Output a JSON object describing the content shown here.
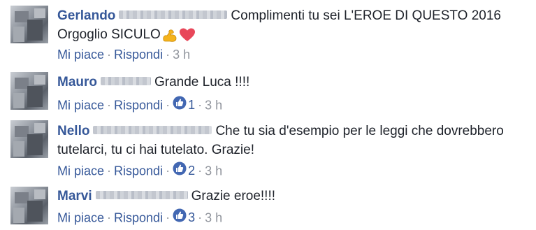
{
  "comments": [
    {
      "name": "Gerlando",
      "name_hidden": true,
      "text_line1": "Complimenti tu sei L'EROE DI QUESTO 2016",
      "text_line2": "Orgoglio SICULO",
      "emojis": [
        "flexed-biceps",
        "red-heart"
      ],
      "like": "Mi piace",
      "reply": "Rispondi",
      "time": "3 h",
      "likes": ""
    },
    {
      "name": "Mauro",
      "name_hidden": true,
      "text_line1": "Grande Luca !!!!",
      "like": "Mi piace",
      "reply": "Rispondi",
      "time": "3 h",
      "likes": "1"
    },
    {
      "name": "Nello",
      "name_hidden": true,
      "text_line1": "Che tu sia d'esempio per le leggi che dovrebbero",
      "text_line2": "tutelarci, tu ci hai tutelato. Grazie!",
      "like": "Mi piace",
      "reply": "Rispondi",
      "time": "3 h",
      "likes": "2"
    },
    {
      "name": "Marvi",
      "name_hidden": true,
      "text_line1": "Grazie eroe!!!!",
      "like": "Mi piace",
      "reply": "Rispondi",
      "time": "3 h",
      "likes": "3"
    }
  ],
  "separator": "·",
  "colors": {
    "link": "#365899",
    "meta": "#90949c",
    "text": "#1d2129",
    "like_badge": "#4267b2"
  }
}
